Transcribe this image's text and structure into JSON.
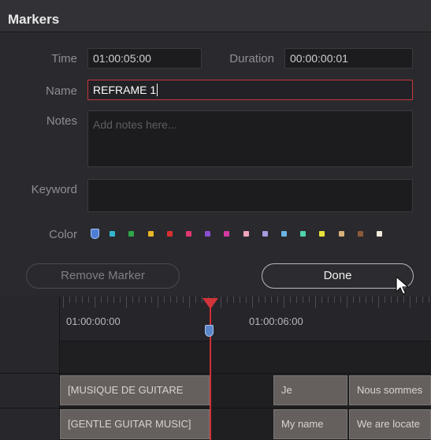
{
  "dialog": {
    "title": "Markers",
    "time_label": "Time",
    "time_value": "01:00:05:00",
    "duration_label": "Duration",
    "duration_value": "00:00:00:01",
    "name_label": "Name",
    "name_value": "REFRAME 1",
    "notes_label": "Notes",
    "notes_placeholder": "Add notes here...",
    "keyword_label": "Keyword",
    "keyword_value": "",
    "color_label": "Color",
    "selected_color": "blue",
    "colors": [
      {
        "name": "blue",
        "hex": "#4f7fd2"
      },
      {
        "name": "cyan",
        "hex": "#35b6cf"
      },
      {
        "name": "green",
        "hex": "#2fa64a"
      },
      {
        "name": "yellow",
        "hex": "#e8b626"
      },
      {
        "name": "red",
        "hex": "#d9302f"
      },
      {
        "name": "pink",
        "hex": "#e1386f"
      },
      {
        "name": "purple",
        "hex": "#8a4fd0"
      },
      {
        "name": "fuchsia",
        "hex": "#d23aa2"
      },
      {
        "name": "rose",
        "hex": "#f0a4bb"
      },
      {
        "name": "lavender",
        "hex": "#a99ae0"
      },
      {
        "name": "sky",
        "hex": "#6ab4e8"
      },
      {
        "name": "mint",
        "hex": "#4ed3ae"
      },
      {
        "name": "lemon",
        "hex": "#e8e33a"
      },
      {
        "name": "sand",
        "hex": "#d9b179"
      },
      {
        "name": "cocoa",
        "hex": "#8c5a3a"
      },
      {
        "name": "cream",
        "hex": "#f2eadb"
      }
    ],
    "remove_marker_label": "Remove Marker",
    "done_label": "Done"
  },
  "timeline": {
    "timecode_left": "01:00:00:00",
    "timecode_right": "01:00:06:00",
    "track_upper_clips": [
      "[MUSIQUE DE GUITARE",
      "Je",
      "Nous sommes"
    ],
    "track_lower_clips": [
      "[GENTLE GUITAR MUSIC]",
      "My name",
      "We are locate"
    ]
  },
  "accent_colors": {
    "active_field_border": "#c8363c",
    "playhead": "#cf3036",
    "marker": "#5b86c8"
  }
}
